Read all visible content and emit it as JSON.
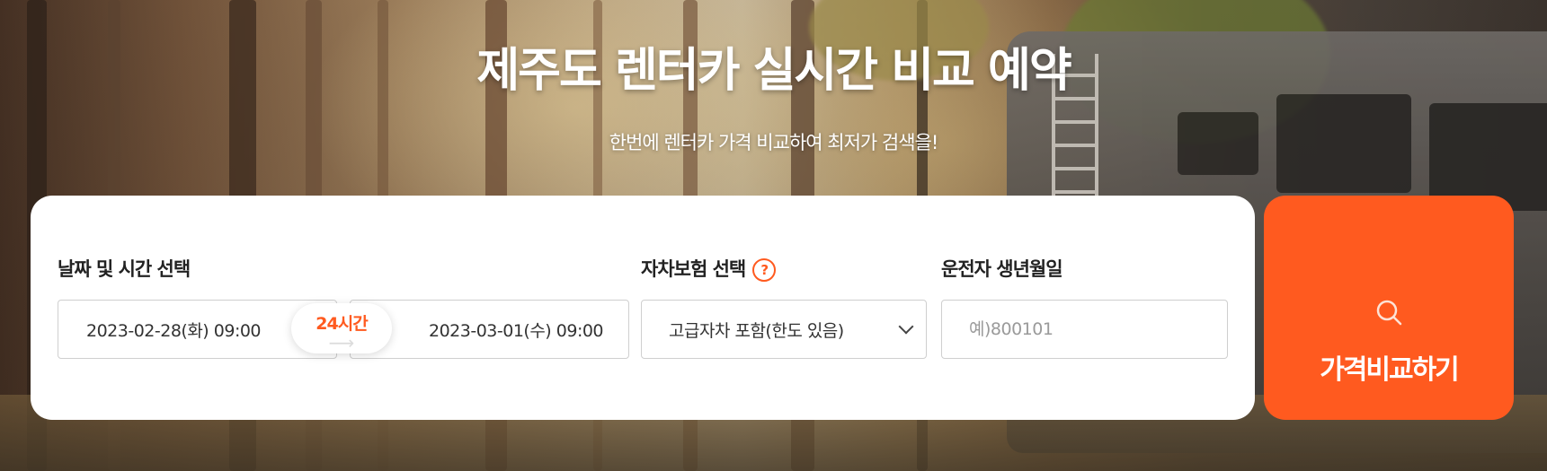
{
  "hero": {
    "title": "제주도 렌터카 실시간 비교 예약",
    "subtitle": "한번에 렌터카 가격 비교하여 최저가 검색을!"
  },
  "search": {
    "date_label": "날짜 및 시간 선택",
    "pickup_datetime": "2023-02-28(화)  09:00",
    "return_datetime": "2023-03-01(수)  09:00",
    "duration": "24시간",
    "insurance_label": "자차보험 선택",
    "insurance_help_icon": "question-circle-icon",
    "insurance_selected": "고급자차 포함(한도 있음)",
    "birth_label": "운전자 생년월일",
    "birth_placeholder": "예)800101",
    "birth_value": ""
  },
  "cta": {
    "icon": "search-icon",
    "label": "가격비교하기"
  },
  "colors": {
    "accent": "#ff5a1f",
    "card": "#ffffff",
    "border": "#cfcfcf"
  }
}
